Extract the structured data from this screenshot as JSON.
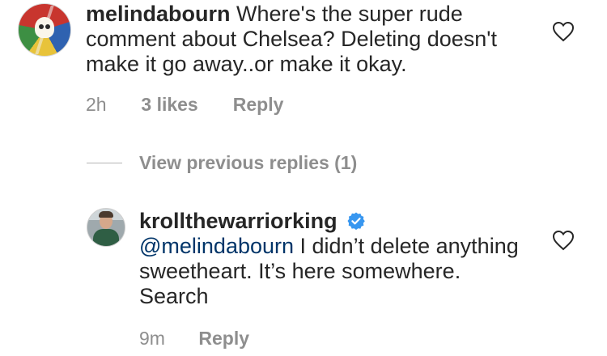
{
  "comment": {
    "username": "melindabourn",
    "text": "Where's the super rude comment about Chelsea? Deleting doesn't make it go away..or make it okay.",
    "time": "2h",
    "likes": "3 likes",
    "reply_label": "Reply",
    "avatar_icon": "grateful-dead-skull-avatar",
    "like_icon": "heart-outline-icon"
  },
  "thread": {
    "view_previous_label": "View previous replies (1)"
  },
  "reply": {
    "username": "krollthewarriorking",
    "verified": true,
    "mention": "@melindabourn",
    "text": " I didn’t delete anything sweetheart. It’s here somewhere. Search",
    "time": "9m",
    "reply_label": "Reply",
    "avatar_icon": "profile-photo-avatar",
    "like_icon": "heart-outline-icon"
  },
  "colors": {
    "text": "#262626",
    "muted": "#8e8e8e",
    "mention": "#003569",
    "verified": "#3897f0"
  }
}
